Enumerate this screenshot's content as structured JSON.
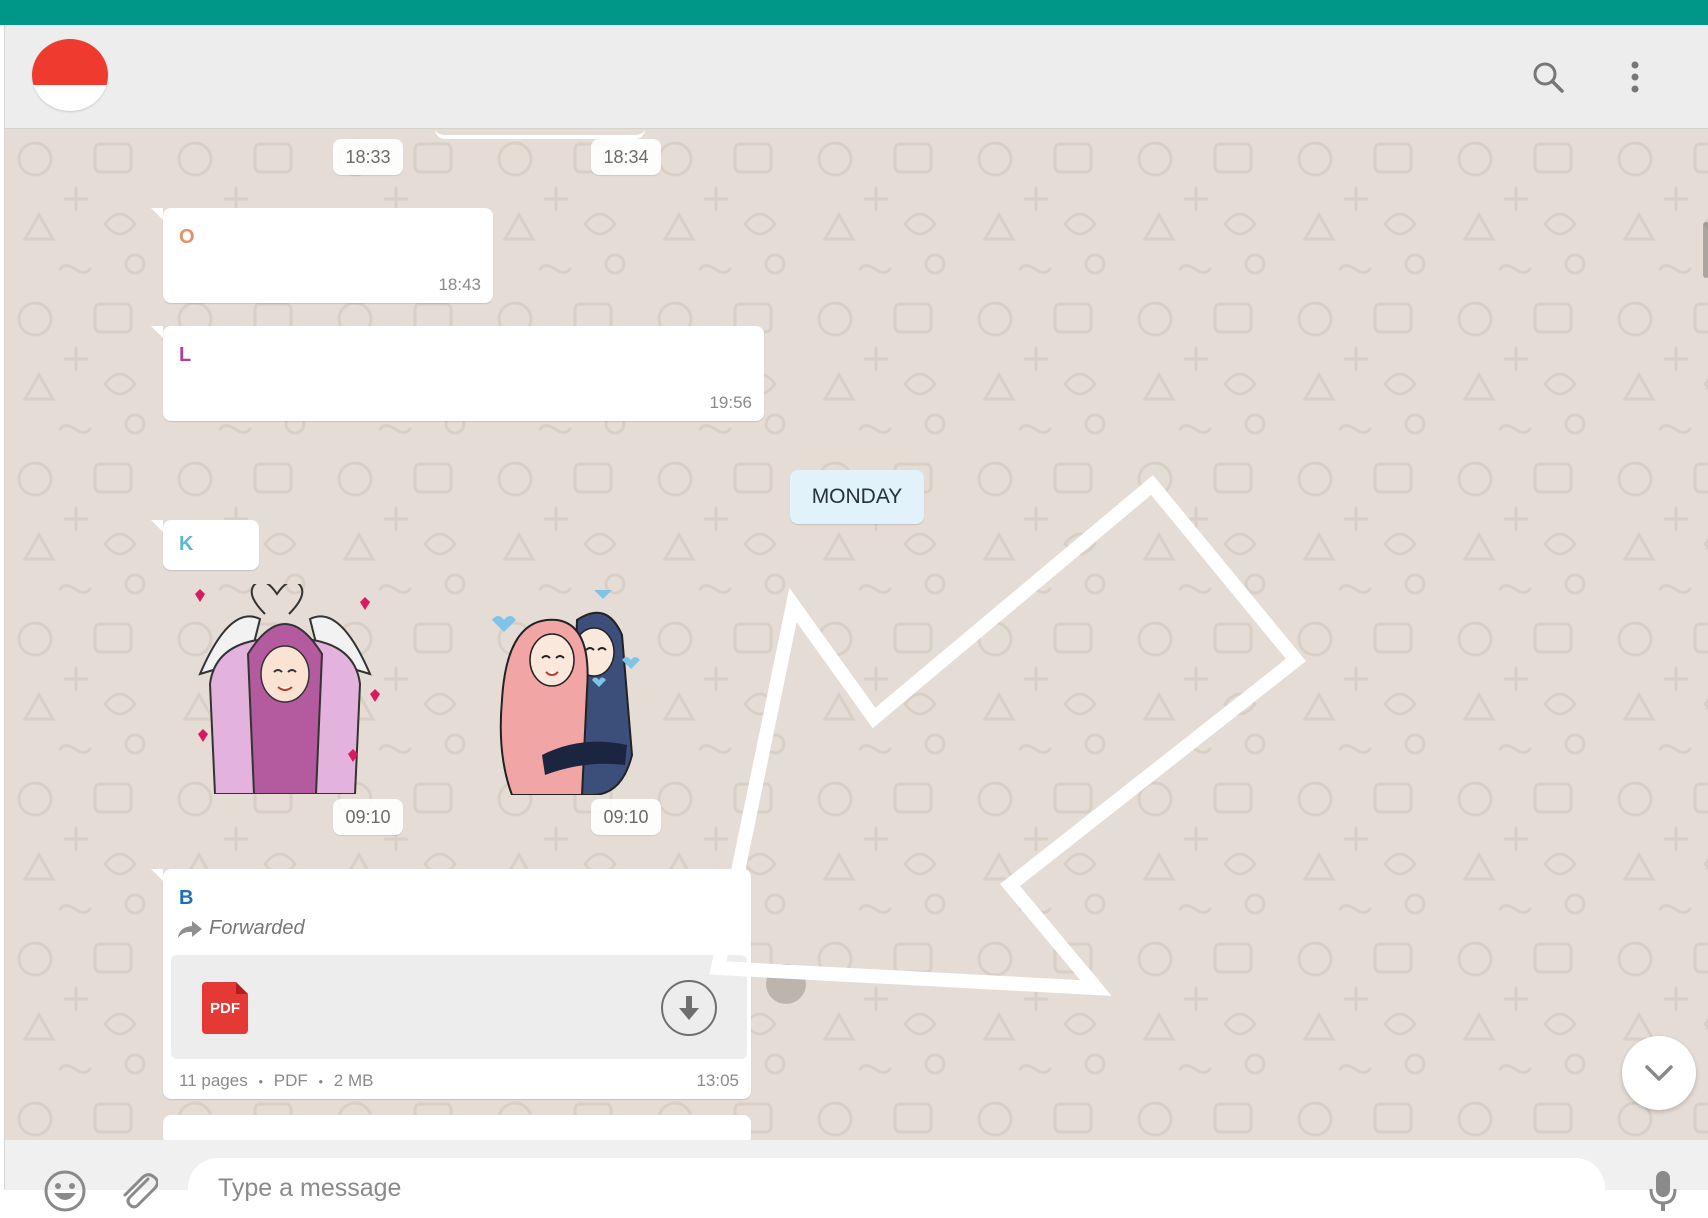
{
  "colors": {
    "accent": "#009688",
    "header_bg": "#ededed",
    "chat_bg": "#e5ddd5",
    "day_chip_bg": "#e1f2fb",
    "pdf_red": "#e53935"
  },
  "header": {
    "avatar_icon": "group-avatar",
    "search_icon": "search-icon",
    "menu_icon": "more-vertical-icon"
  },
  "messages": {
    "top_time_left": "18:33",
    "top_time_right": "18:34",
    "msg1": {
      "sender": "O",
      "sender_color": "#e39166",
      "time": "18:43"
    },
    "msg2": {
      "sender": "L",
      "sender_color": "#b03e9a",
      "time": "19:56"
    },
    "day_separator": "MONDAY",
    "msg3": {
      "sender": "K",
      "sender_color": "#5bb8d4"
    },
    "sticker_times": [
      "09:10",
      "09:10"
    ],
    "doc_message": {
      "sender": "B",
      "sender_color": "#1f6fb5",
      "forwarded_label": "Forwarded",
      "file_badge": "PDF",
      "pages": "11 pages",
      "type": "PDF",
      "size": "2 MB",
      "separator": "•",
      "time": "13:05"
    }
  },
  "footer": {
    "placeholder": "Type a message",
    "emoji_icon": "emoji-icon",
    "attach_icon": "paperclip-icon",
    "mic_icon": "microphone-icon"
  }
}
